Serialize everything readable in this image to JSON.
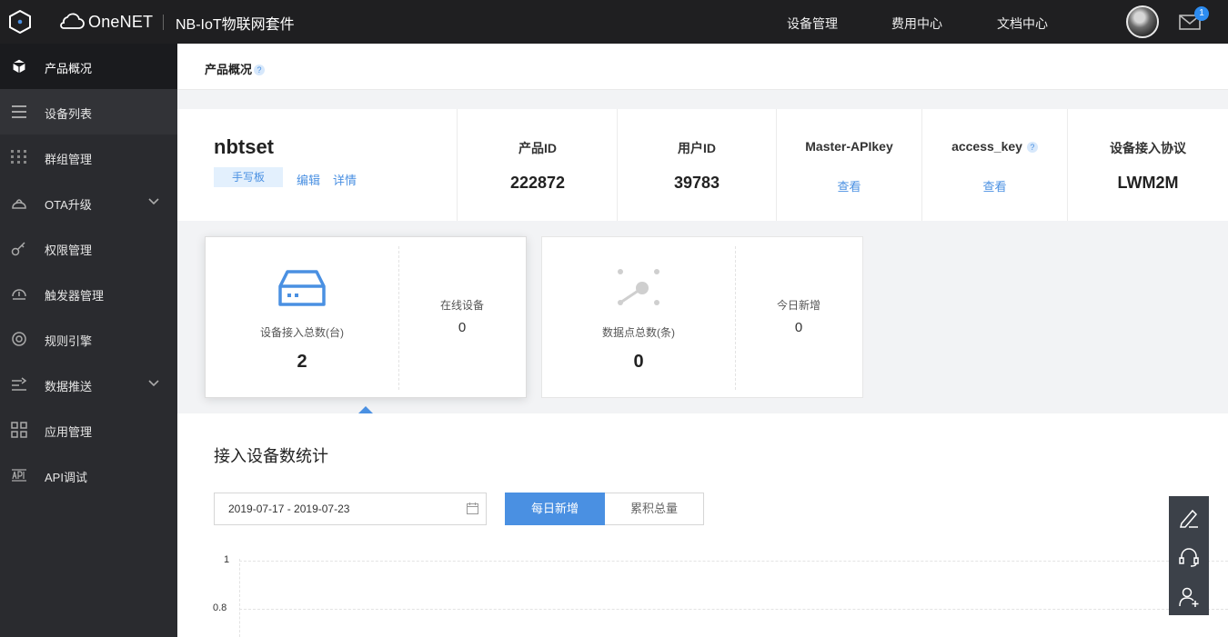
{
  "topbar": {
    "brand": "OneNET",
    "product_kit": "NB-IoT物联网套件",
    "nav": [
      "设备管理",
      "费用中心",
      "文档中心"
    ],
    "mail_badge": "1"
  },
  "sidebar": {
    "items": [
      {
        "label": "产品概况",
        "icon": "cube-icon"
      },
      {
        "label": "设备列表",
        "icon": "list-icon"
      },
      {
        "label": "群组管理",
        "icon": "grid-dots-icon"
      },
      {
        "label": "OTA升级",
        "icon": "upload-icon"
      },
      {
        "label": "权限管理",
        "icon": "key-icon"
      },
      {
        "label": "触发器管理",
        "icon": "gauge-icon"
      },
      {
        "label": "规则引擎",
        "icon": "target-icon"
      },
      {
        "label": "数据推送",
        "icon": "push-icon"
      },
      {
        "label": "应用管理",
        "icon": "apps-icon"
      },
      {
        "label": "API调试",
        "icon": "api-icon"
      }
    ]
  },
  "breadcrumb": {
    "title": "产品概况",
    "help": "?"
  },
  "product": {
    "name": "nbtset",
    "tag": "手写板",
    "edit": "编辑",
    "detail": "详情",
    "fields": [
      {
        "label": "产品ID",
        "value": "222872"
      },
      {
        "label": "用户ID",
        "value": "39783"
      },
      {
        "label": "Master-APIkey",
        "link": "查看"
      },
      {
        "label": "access_key",
        "link": "查看",
        "help": "?"
      },
      {
        "label": "设备接入协议",
        "value": "LWM2M"
      }
    ]
  },
  "cards": [
    {
      "label": "设备接入总数(台)",
      "value": "2",
      "side_label": "在线设备",
      "side_value": "0",
      "icon": "server-icon",
      "color": "#4a90e2"
    },
    {
      "label": "数据点总数(条)",
      "value": "0",
      "side_label": "今日新增",
      "side_value": "0",
      "icon": "datapoint-icon",
      "color": "#cfcfcf"
    }
  ],
  "stats": {
    "title": "接入设备数统计",
    "date_range": "2019-07-17 - 2019-07-23",
    "toggle_on": "每日新增",
    "toggle_off": "累积总量",
    "yticks": [
      "1",
      "0.8"
    ]
  },
  "colors": {
    "accent": "#4a90e2",
    "topbar": "#1f1f21",
    "sidebar": "#2a2b2f"
  }
}
